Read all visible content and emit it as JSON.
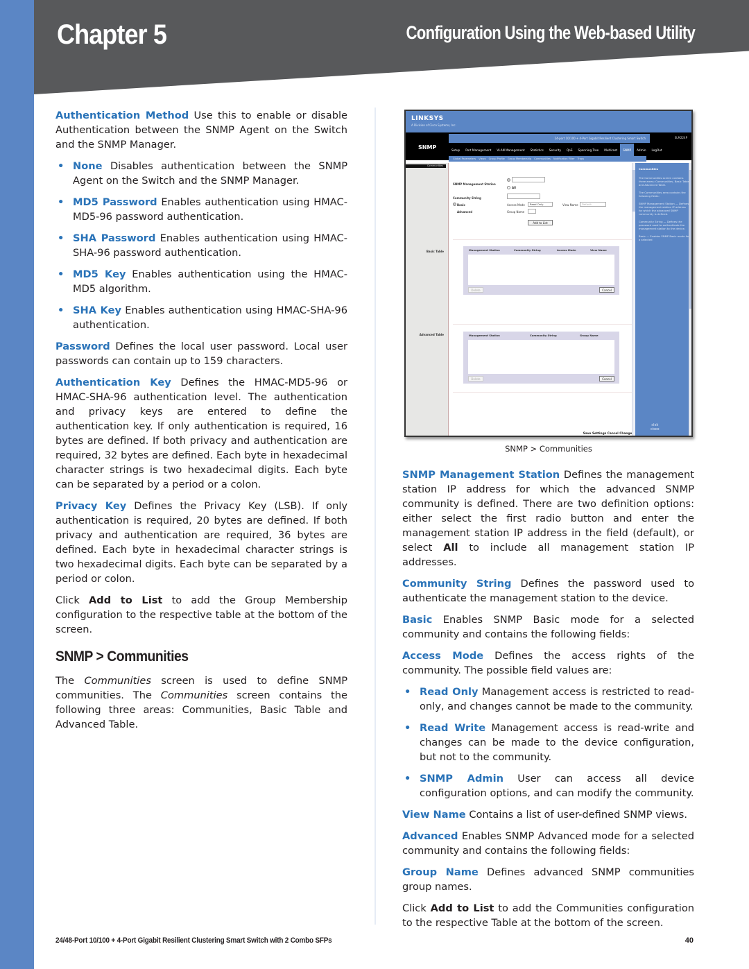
{
  "header": {
    "chapter": "Chapter 5",
    "title": "Configuration Using the Web-based Utility"
  },
  "left_column": {
    "auth_method": {
      "term": "Authentication Method",
      "text": "Use this to enable or disable Authentication between the SNMP Agent on the Switch and the SNMP Manager."
    },
    "auth_bullets": [
      {
        "term": "None",
        "text": "Disables authentication between the SNMP Agent on the Switch and the SNMP Manager."
      },
      {
        "term": "MD5 Password",
        "text": "Enables authentication using HMAC-MD5-96 password authentication."
      },
      {
        "term": "SHA Password",
        "text": "Enables authentication using HMAC-SHA-96 password authentication."
      },
      {
        "term": "MD5 Key",
        "text": "Enables authentication using the HMAC-MD5 algorithm."
      },
      {
        "term": "SHA Key",
        "text": "Enables authentication using HMAC-SHA-96 authentication."
      }
    ],
    "password": {
      "term": "Password",
      "text": "Defines the local user password. Local user passwords can contain up to 159 characters."
    },
    "auth_key": {
      "term": "Authentication Key",
      "text": "Defines the HMAC-MD5-96 or HMAC-SHA-96 authentication level. The authentication and privacy keys are entered to define the authentication key. If only authentication is required, 16 bytes are defined. If both privacy and authentication are required, 32 bytes are defined. Each byte in hexadecimal character strings is two hexadecimal digits. Each byte can be separated by a period or a colon."
    },
    "privacy_key": {
      "term": "Privacy Key",
      "text": "Defines the Privacy Key (LSB). If only authentication is required, 20 bytes are defined. If both privacy and authentication are required, 36 bytes are defined. Each byte in hexadecimal character strings is two hexadecimal digits. Each byte can be separated by a period or colon."
    },
    "add_to_list": {
      "prefix": "Click",
      "bold": "Add to List",
      "suffix": "to add the Group Membership configuration to the respective table at the bottom of the screen."
    },
    "section_heading": "SNMP > Communities",
    "intro": {
      "part1": "The",
      "em1": "Communities",
      "part2": "screen is used to define SNMP communities. The",
      "em2": "Communities",
      "part3": "screen contains the following three areas: Communities, Basic Table and Advanced Table."
    }
  },
  "figure": {
    "logo": "LINKSYS",
    "logo_sub": "A Division of Cisco Systems, Inc.",
    "section": "SNMP",
    "product_bar": "24-port 10/100 + 4-Port Gigabit Resilient Clustering Smart Switch",
    "model": "SLM224P",
    "nav": [
      "Setup",
      "Port Management",
      "VLAN Management",
      "Statistics",
      "Security",
      "QoS",
      "Spanning Tree",
      "Multicast",
      "SNMP",
      "Admin",
      "LogOut"
    ],
    "subnav": [
      "Global Parameters",
      "Views",
      "Group Profile",
      "Group Membership",
      "Communities",
      "Notification Filter",
      "Traps"
    ],
    "sidebar_item": "Communities",
    "sidebar_labels": {
      "basic_table": "Basic Table",
      "advanced_table": "Advanced Table"
    },
    "form": {
      "mgmt_station_label": "SNMP Management Station",
      "all_label": "All",
      "community_string_label": "Community String",
      "basic_label": "Basic",
      "advanced_label": "Advanced",
      "access_mode_label": "Access Mode",
      "access_mode_value": "Read Only",
      "view_name_label": "View Name",
      "view_name_value": "Default",
      "group_name_label": "Group Name",
      "add_button": "Add to List"
    },
    "basic_table": {
      "columns": [
        "Management Station",
        "Community String",
        "Access Mode",
        "View Name"
      ],
      "delete": "Delete",
      "cancel": "Cancel"
    },
    "advanced_table": {
      "columns": [
        "Management Station",
        "Community String",
        "Group Name"
      ],
      "delete": "Delete",
      "cancel": "Cancel"
    },
    "help": {
      "title": "Communities",
      "p1": "The Communities screen contains three areas: Communities, Basic Table and Advanced Table.",
      "p2": "The Communities area contains the following fields:",
      "p3": "SNMP Management Station — Defines the management station IP address for which the advanced SNMP community is defined.",
      "p4": "Community String — Defines the password used to authenticate the management station to the device.",
      "p5": "Basic — Enables SNMP Basic mode for a selected"
    },
    "cisco": "cisco",
    "save_settings": "Save Settings",
    "cancel_changes": "Cancel Changes",
    "caption": "SNMP >  Communities"
  },
  "right_column": {
    "mgmt_station": {
      "term": "SNMP Management Station",
      "text1": "Defines the management station IP address for which the advanced SNMP community is defined. There are two definition options: either select the first radio button and enter the management station IP address in the field (default), or select",
      "bold": "All",
      "text2": "to include all management station IP addresses."
    },
    "community_string": {
      "term": "Community String",
      "text": "Defines the password used to authenticate the management station to the device."
    },
    "basic": {
      "term": "Basic",
      "text": "Enables SNMP Basic mode for a selected community and contains the following fields:"
    },
    "access_mode": {
      "term": "Access Mode",
      "text": "Defines the access rights of the community. The possible field values are:"
    },
    "access_bullets": [
      {
        "term": "Read Only",
        "text": "Management access is restricted to read-only, and changes cannot be made to the community."
      },
      {
        "term": "Read Write",
        "text": "Management access is read-write and changes can be made to the device configuration, but not to the community."
      },
      {
        "term": "SNMP Admin",
        "text": "User can access all device configuration options, and can modify the community."
      }
    ],
    "view_name": {
      "term": "View Name",
      "text": "Contains a list of user-defined SNMP views."
    },
    "advanced": {
      "term": "Advanced",
      "text": "Enables SNMP Advanced mode for a selected community and contains the following fields:"
    },
    "group_name": {
      "term": "Group Name",
      "text": "Defines advanced SNMP communities group names."
    },
    "add_to_list": {
      "prefix": "Click",
      "bold": "Add to List",
      "suffix": "to add the Communities configuration to the respective Table at the bottom of the screen."
    }
  },
  "footer": {
    "product": "24/48-Port 10/100 + 4-Port Gigabit Resilient Clustering Smart Switch with 2 Combo SFPs",
    "page": "40"
  }
}
